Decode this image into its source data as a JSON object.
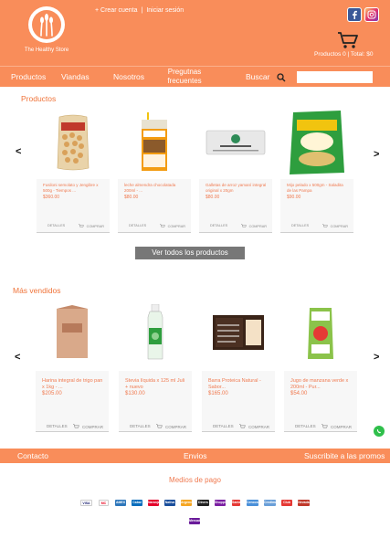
{
  "header": {
    "logo_name": "The Healthy Store",
    "create_account": "+ Crear cuenta",
    "separator": "|",
    "login": "Iniciar sesión",
    "cart_text": "Productos 0  | Total: $0"
  },
  "nav": {
    "items": [
      "Productos",
      "Viandas",
      "Nosotros",
      "Pregutnas frecuentes"
    ],
    "search_label": "Buscar",
    "search_placeholder": ""
  },
  "products_section": {
    "title": "Productos",
    "items": [
      {
        "title": "Fusiloni semolato y Jengibre x 500g - Tiempos ...",
        "price": "$360.00"
      },
      {
        "title": "leche almendra chocolatada 200ml - ...",
        "price": "$80.00"
      },
      {
        "title": "Galletas de arroz yamaní integral original x 20gm",
        "price": "$80.00"
      },
      {
        "title": "Mijo pelado x 500gm - Saladita de las Pampa",
        "price": "$90.00"
      }
    ],
    "detail_label": "DETALLES",
    "buy_label": "COMPRAR",
    "view_all": "Ver todos los productos"
  },
  "bestsellers_section": {
    "title": "Más vendidos",
    "items": [
      {
        "title": "Harina integral de trigo pan x 1kg - ...",
        "price": "$205.00"
      },
      {
        "title": "Stevia líquida x 125 ml Juli + nuevo",
        "price": "$130.00"
      },
      {
        "title": "Barra Proteica Natural - Sabor...",
        "price": "$165.00"
      },
      {
        "title": "Jugo de manzana verde x 200ml - Pur...",
        "price": "$54.00"
      }
    ],
    "detail_label": "DETALLES",
    "buy_label": "COMPRAR"
  },
  "footer": {
    "contact": "Contacto",
    "shipping": "Envios",
    "subscribe": "Suscribite a las promos",
    "payment_title": "Medios de pago",
    "payment_methods": [
      "VISA",
      "MC",
      "AMEX",
      "Cabal",
      "Naranja",
      "Nativa",
      "Argencard",
      "Diners",
      "Shopping",
      "Santander",
      "Cencosud",
      "Credimas",
      "Club Día",
      "Nevada",
      "Mercado Pago"
    ]
  },
  "colors": {
    "brand_orange": "#f98d5a",
    "accent_text": "#f07a50",
    "button_gray": "#777777"
  },
  "icons": [
    "wheat-logo-icon",
    "facebook-icon",
    "instagram-icon",
    "cart-icon",
    "search-icon",
    "whatsapp-icon",
    "chevron-left-icon",
    "chevron-right-icon"
  ]
}
